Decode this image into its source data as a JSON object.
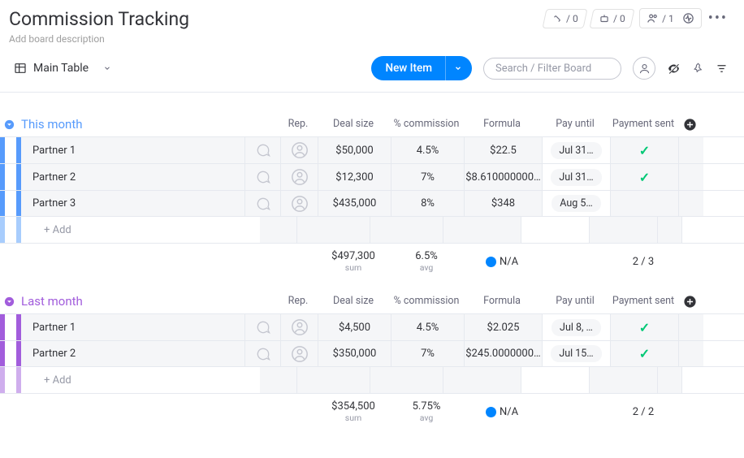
{
  "header": {
    "title": "Commission Tracking",
    "description": "Add board description",
    "pill1_count": "0",
    "pill2_count": "0",
    "pill3_count": "1"
  },
  "toolbar": {
    "view_label": "Main Table",
    "new_item_label": "New Item",
    "search_placeholder": "Search / Filter Board"
  },
  "columns": {
    "rep": "Rep.",
    "deal": "Deal size",
    "comm": "% commission",
    "formula": "Formula",
    "pay": "Pay until",
    "sent": "Payment sent"
  },
  "groups": [
    {
      "title": "This month",
      "color": "blue",
      "rows": [
        {
          "name": "Partner 1",
          "deal": "$50,000",
          "comm": "4.5%",
          "formula": "$22.5",
          "pay": "Jul 31…",
          "sent": true
        },
        {
          "name": "Partner 2",
          "deal": "$12,300",
          "comm": "7%",
          "formula": "$8.610000000…",
          "pay": "Jul 31…",
          "sent": true
        },
        {
          "name": "Partner 3",
          "deal": "$435,000",
          "comm": "8%",
          "formula": "$348",
          "pay": "Aug 5…",
          "sent": false
        }
      ],
      "summary": {
        "deal": "$497,300",
        "deal_sub": "sum",
        "comm": "6.5%",
        "comm_sub": "avg",
        "formula": "N/A",
        "sent": "2 / 3"
      }
    },
    {
      "title": "Last month",
      "color": "purple",
      "rows": [
        {
          "name": "Partner 1",
          "deal": "$4,500",
          "comm": "4.5%",
          "formula": "$2.025",
          "pay": "Jul 8, …",
          "sent": true
        },
        {
          "name": "Partner 2",
          "deal": "$350,000",
          "comm": "7%",
          "formula": "$245.0000000…",
          "pay": "Jul 15…",
          "sent": true
        }
      ],
      "summary": {
        "deal": "$354,500",
        "deal_sub": "sum",
        "comm": "5.75%",
        "comm_sub": "avg",
        "formula": "N/A",
        "sent": "2 / 2"
      }
    }
  ],
  "add_row_label": "+ Add"
}
